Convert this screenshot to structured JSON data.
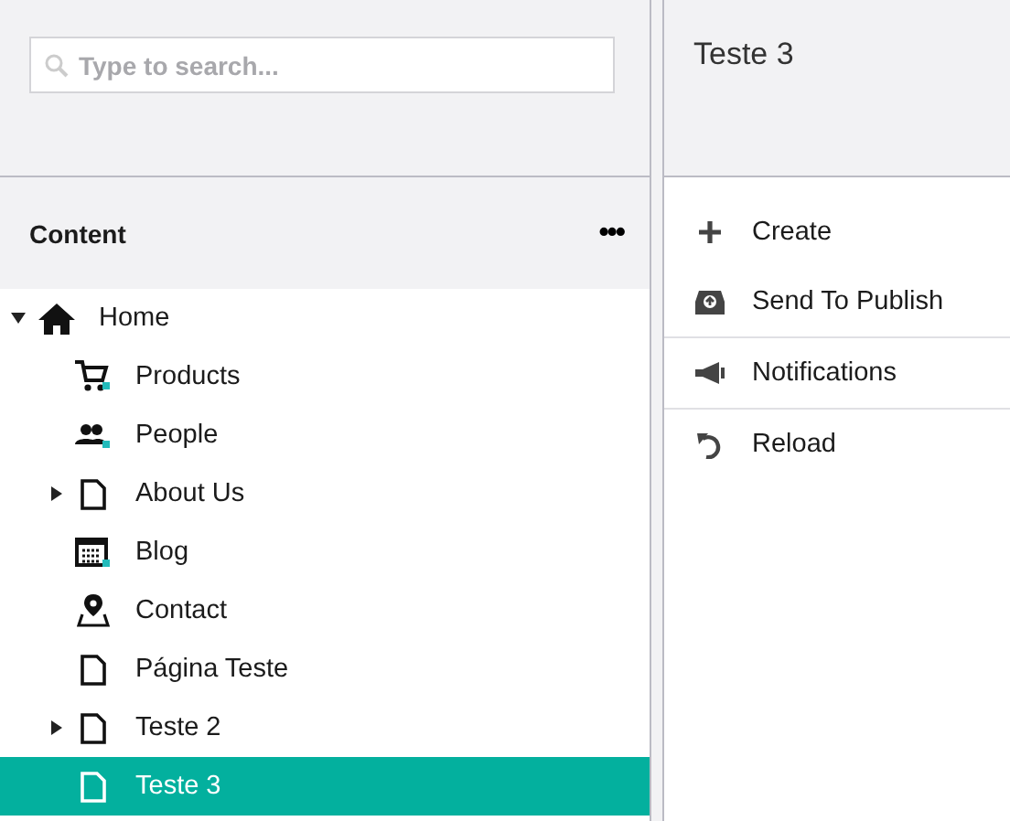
{
  "search": {
    "placeholder": "Type to search..."
  },
  "tree": {
    "title": "Content",
    "menu_icon": "•••",
    "items": [
      {
        "label": "Home",
        "kind": "home",
        "expanded": true,
        "selected": false,
        "children": [
          {
            "label": "Products",
            "kind": "cart",
            "selected": false
          },
          {
            "label": "People",
            "kind": "people",
            "selected": false
          },
          {
            "label": "About Us",
            "kind": "page",
            "expanded": false,
            "selected": false
          },
          {
            "label": "Blog",
            "kind": "calendar",
            "selected": false
          },
          {
            "label": "Contact",
            "kind": "pin",
            "selected": false
          },
          {
            "label": "Página Teste",
            "kind": "page",
            "selected": false
          },
          {
            "label": "Teste 2",
            "kind": "page",
            "expanded": false,
            "selected": false
          },
          {
            "label": "Teste 3",
            "kind": "page",
            "selected": true
          }
        ]
      }
    ]
  },
  "panel": {
    "title": "Teste 3",
    "actions": [
      {
        "label": "Create",
        "kind": "plus",
        "divider_below": false
      },
      {
        "label": "Send To Publish",
        "kind": "inbox",
        "divider_below": true
      },
      {
        "label": "Notifications",
        "kind": "megaphone",
        "divider_below": true
      },
      {
        "label": "Reload",
        "kind": "reload",
        "divider_below": false
      }
    ]
  }
}
